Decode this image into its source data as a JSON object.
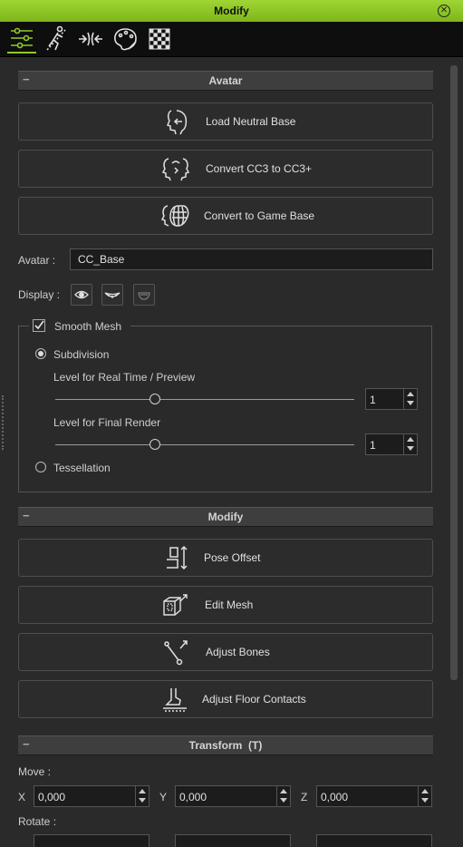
{
  "window": {
    "title": "Modify",
    "close_icon": "close-circle-icon"
  },
  "toolbar": {
    "tabs": [
      {
        "icon": "sliders-icon",
        "active": true
      },
      {
        "icon": "motion-pose-icon",
        "active": false
      },
      {
        "icon": "morph-icon",
        "active": false
      },
      {
        "icon": "material-palette-icon",
        "active": false
      },
      {
        "icon": "checker-texture-icon",
        "active": false
      }
    ]
  },
  "avatar_section": {
    "header": "Avatar",
    "collapse_symbol": "−",
    "buttons": [
      {
        "label": "Load Neutral Base",
        "icon": "load-neutral-base-icon"
      },
      {
        "label": "Convert CC3 to CC3+",
        "icon": "convert-cc3-icon"
      },
      {
        "label": "Convert to Game Base",
        "icon": "game-base-icon"
      }
    ],
    "avatar_label": "Avatar :",
    "avatar_value": "CC_Base",
    "display_label": "Display :"
  },
  "smooth_mesh": {
    "label": "Smooth Mesh",
    "checked": true,
    "subdivision_label": "Subdivision",
    "subdivision_selected": true,
    "realtime_label": "Level for Real Time / Preview",
    "realtime_value": "1",
    "realtime_slider": 0.33,
    "final_label": "Level for Final Render",
    "final_value": "1",
    "final_slider": 0.33,
    "tessellation_label": "Tessellation",
    "tessellation_selected": false
  },
  "modify_section": {
    "header": "Modify",
    "collapse_symbol": "−",
    "buttons": [
      {
        "label": "Pose Offset",
        "icon": "pose-offset-icon"
      },
      {
        "label": "Edit Mesh",
        "icon": "edit-mesh-icon"
      },
      {
        "label": "Adjust Bones",
        "icon": "adjust-bones-icon"
      },
      {
        "label": "Adjust Floor Contacts",
        "icon": "floor-contacts-icon"
      }
    ]
  },
  "transform_section": {
    "header": "Transform  (T)",
    "collapse_symbol": "−",
    "move_label": "Move :",
    "x_label": "X",
    "y_label": "Y",
    "z_label": "Z",
    "move_x": "0,000",
    "move_y": "0,000",
    "move_z": "0,000",
    "rotate_label": "Rotate :"
  }
}
